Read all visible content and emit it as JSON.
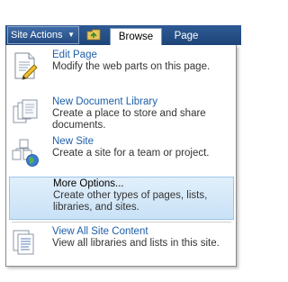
{
  "ribbon": {
    "site_actions_label": "Site Actions",
    "tabs": [
      {
        "label": "Browse",
        "selected": true
      },
      {
        "label": "Page",
        "selected": false
      }
    ]
  },
  "menu": {
    "items": [
      {
        "title": "Edit Page",
        "description": "Modify the web parts on this page.",
        "icon": "edit-page-icon",
        "highlighted": false
      },
      {
        "title": "New Document Library",
        "description": "Create a place to store and share documents.",
        "icon": "new-document-library-icon",
        "highlighted": false
      },
      {
        "title": "New Site",
        "description": "Create a site for a team or project.",
        "icon": "new-site-icon",
        "highlighted": false
      },
      {
        "title": "More Options...",
        "description": "Create other types of pages, lists, libraries, and sites.",
        "icon": "",
        "highlighted": true
      },
      {
        "title": "View All Site Content",
        "description": "View all libraries and lists in this site.",
        "icon": "view-all-site-content-icon",
        "highlighted": false
      }
    ]
  },
  "colors": {
    "ribbon_blue": "#244b82",
    "link_blue": "#1d5fa8",
    "highlight_bg": "#c9e2f7",
    "highlight_border": "#9ec5ea"
  }
}
